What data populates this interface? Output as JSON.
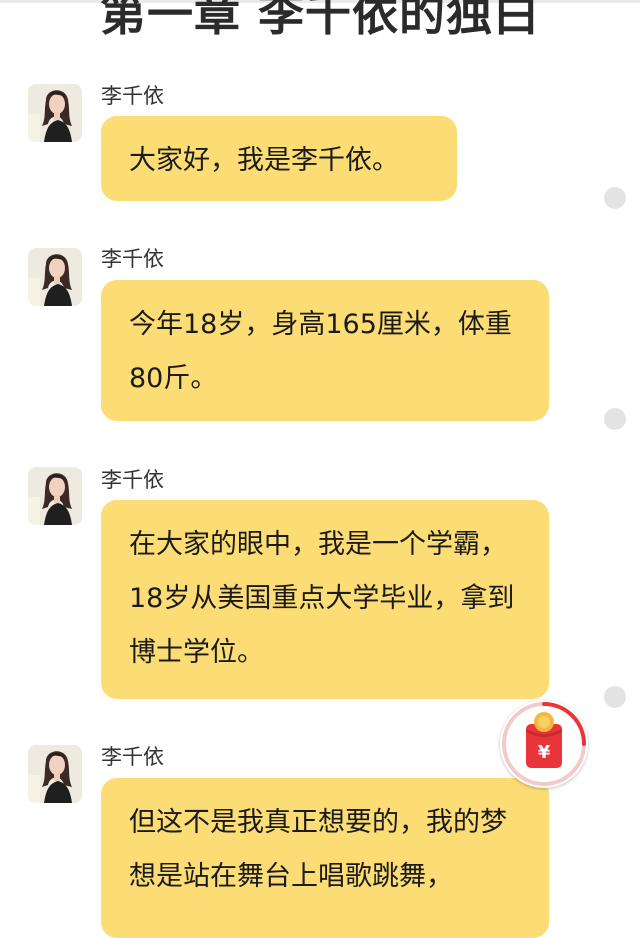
{
  "chapter_title": "第一章 李千依的独白",
  "messages": [
    {
      "sender": "李千依",
      "text": "大家好，我是李千依。"
    },
    {
      "sender": "李千依",
      "text": "今年18岁，身高165厘米，体重80斤。"
    },
    {
      "sender": "李千依",
      "text": "在大家的眼中，我是一个学霸，18岁从美国重点大学毕业，拿到博士学位。"
    },
    {
      "sender": "李千依",
      "text": "但这不是我真正想要的，我的梦想是站在舞台上唱歌跳舞，"
    }
  ],
  "icons": {
    "avatar": "avatar-portrait-icon",
    "red_packet": "red-envelope-yuan-icon",
    "menu_dot": "dot-icon"
  },
  "colors": {
    "bubble": "#fcdc74",
    "red_packet": "#e8353a",
    "coin": "#f4b73a"
  }
}
